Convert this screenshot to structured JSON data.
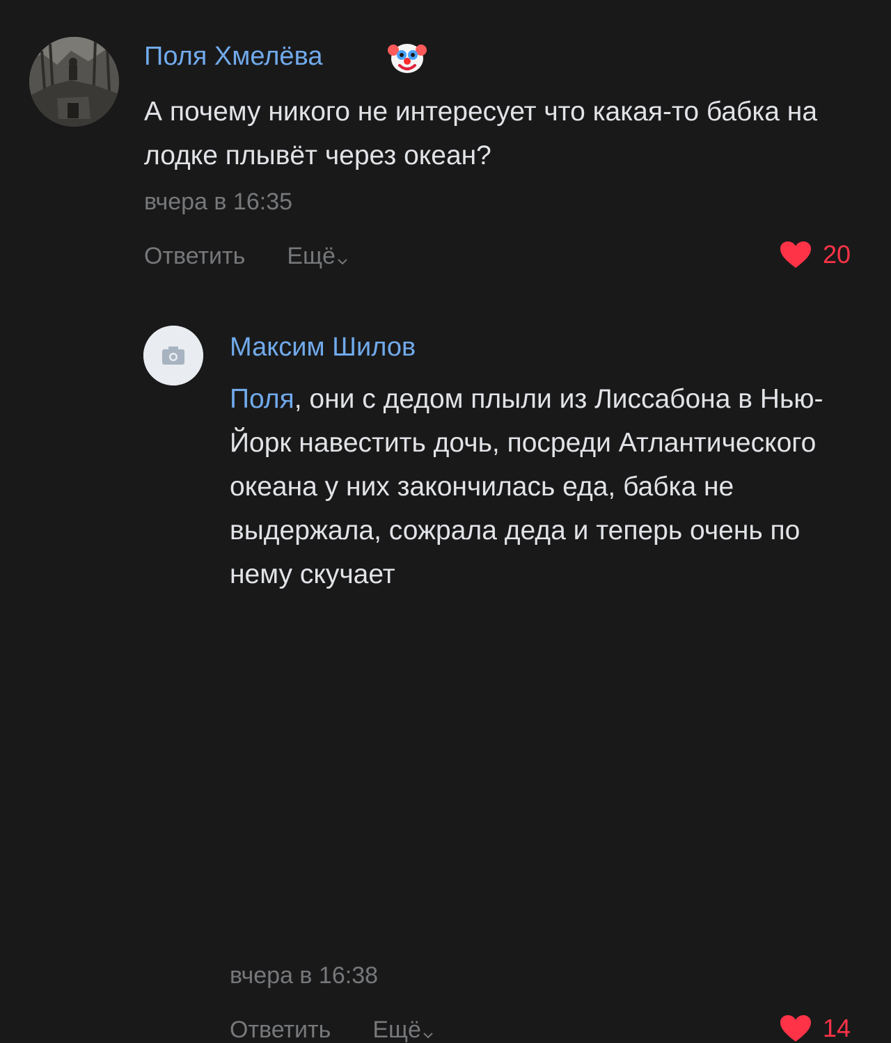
{
  "comments": [
    {
      "author": "Поля Хмелёва",
      "author_emoji": "clown-face",
      "text": "А почему никого не интересует что какая-то бабка на лодке плывёт через океан?",
      "time": "вчера в 16:35",
      "reply_label": "Ответить",
      "more_label": "Ещё",
      "likes": "20",
      "liked": true
    },
    {
      "author": "Максим Шилов",
      "mention": "Поля",
      "text": ", они с дедом плыли из Лиссабона в Нью-Йорк навестить дочь, посреди Атлантического океана у них закончилась еда, бабка не выдержала, сожрала деда и теперь очень по нему скучает",
      "time": "вчера в 16:38",
      "reply_label": "Ответить",
      "more_label": "Ещё",
      "likes": "14",
      "liked": true
    }
  ],
  "colors": {
    "background": "#19191a",
    "link": "#71aaeb",
    "text": "#e1e3e6",
    "secondary": "#76787a",
    "like": "#ff3347"
  },
  "icons": {
    "avatar_placeholder": "camera-icon",
    "like": "heart-icon",
    "more": "chevron-down-icon"
  }
}
